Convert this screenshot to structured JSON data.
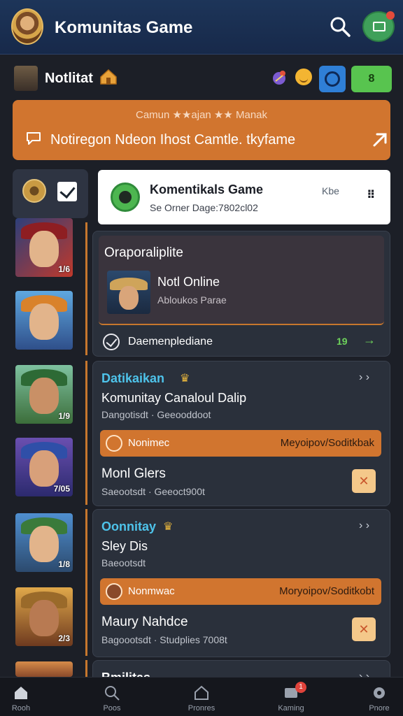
{
  "header": {
    "title": "Komunitas Game"
  },
  "toolbar": {
    "user_name": "Notlitat",
    "green_button": "8"
  },
  "banner": {
    "subtitle": "Camun ★★ajan ★★ Manak",
    "text": "Notiregon Ndeon Ihost Camtle. tkyfame"
  },
  "white_card": {
    "title": "Komentikals Game",
    "subtitle": "Se Orner Dage:7802cl02",
    "tag": "Kbe",
    "more": "⠿"
  },
  "group_card": {
    "title": "Oraporaliplite",
    "status": "Notl Online",
    "location": "Abloukos Parae",
    "footer_label": "Daemenplediane",
    "footer_count": "19"
  },
  "posts": [
    {
      "title": "Datikaikan",
      "line1": "Komunitay Canaloul Dalip",
      "line2": "Dangotisdt · Geeooddoot",
      "strip_left": "Nonimec",
      "strip_right": "Meyoipov/Soditkbak",
      "line3": "Monl Glers",
      "line4": "Saeootsdt · Geeoct900t"
    },
    {
      "title": "Oonnitay",
      "line1": "Sley Dis",
      "line2": "Baeootsdt",
      "strip_left": "Nonmwac",
      "strip_right": "Moryoipov/Soditkobt",
      "line3": "Maury Nahdce",
      "line4": "Bagoootsdt · Studplies 7008t"
    },
    {
      "title": "Bmilitas"
    }
  ],
  "side_levels": [
    "1/6",
    "",
    "1/9",
    "7/05",
    "1/8",
    "2/3"
  ],
  "nav": [
    {
      "label": "Rooh"
    },
    {
      "label": "Poos"
    },
    {
      "label": "Pronres"
    },
    {
      "label": "Kaming",
      "badge": "1"
    },
    {
      "label": "Pnore"
    }
  ],
  "colors": {
    "accent": "#d1752f",
    "header": "#1d3559",
    "highlight": "#4ec3ea",
    "success": "#6ed35b"
  }
}
